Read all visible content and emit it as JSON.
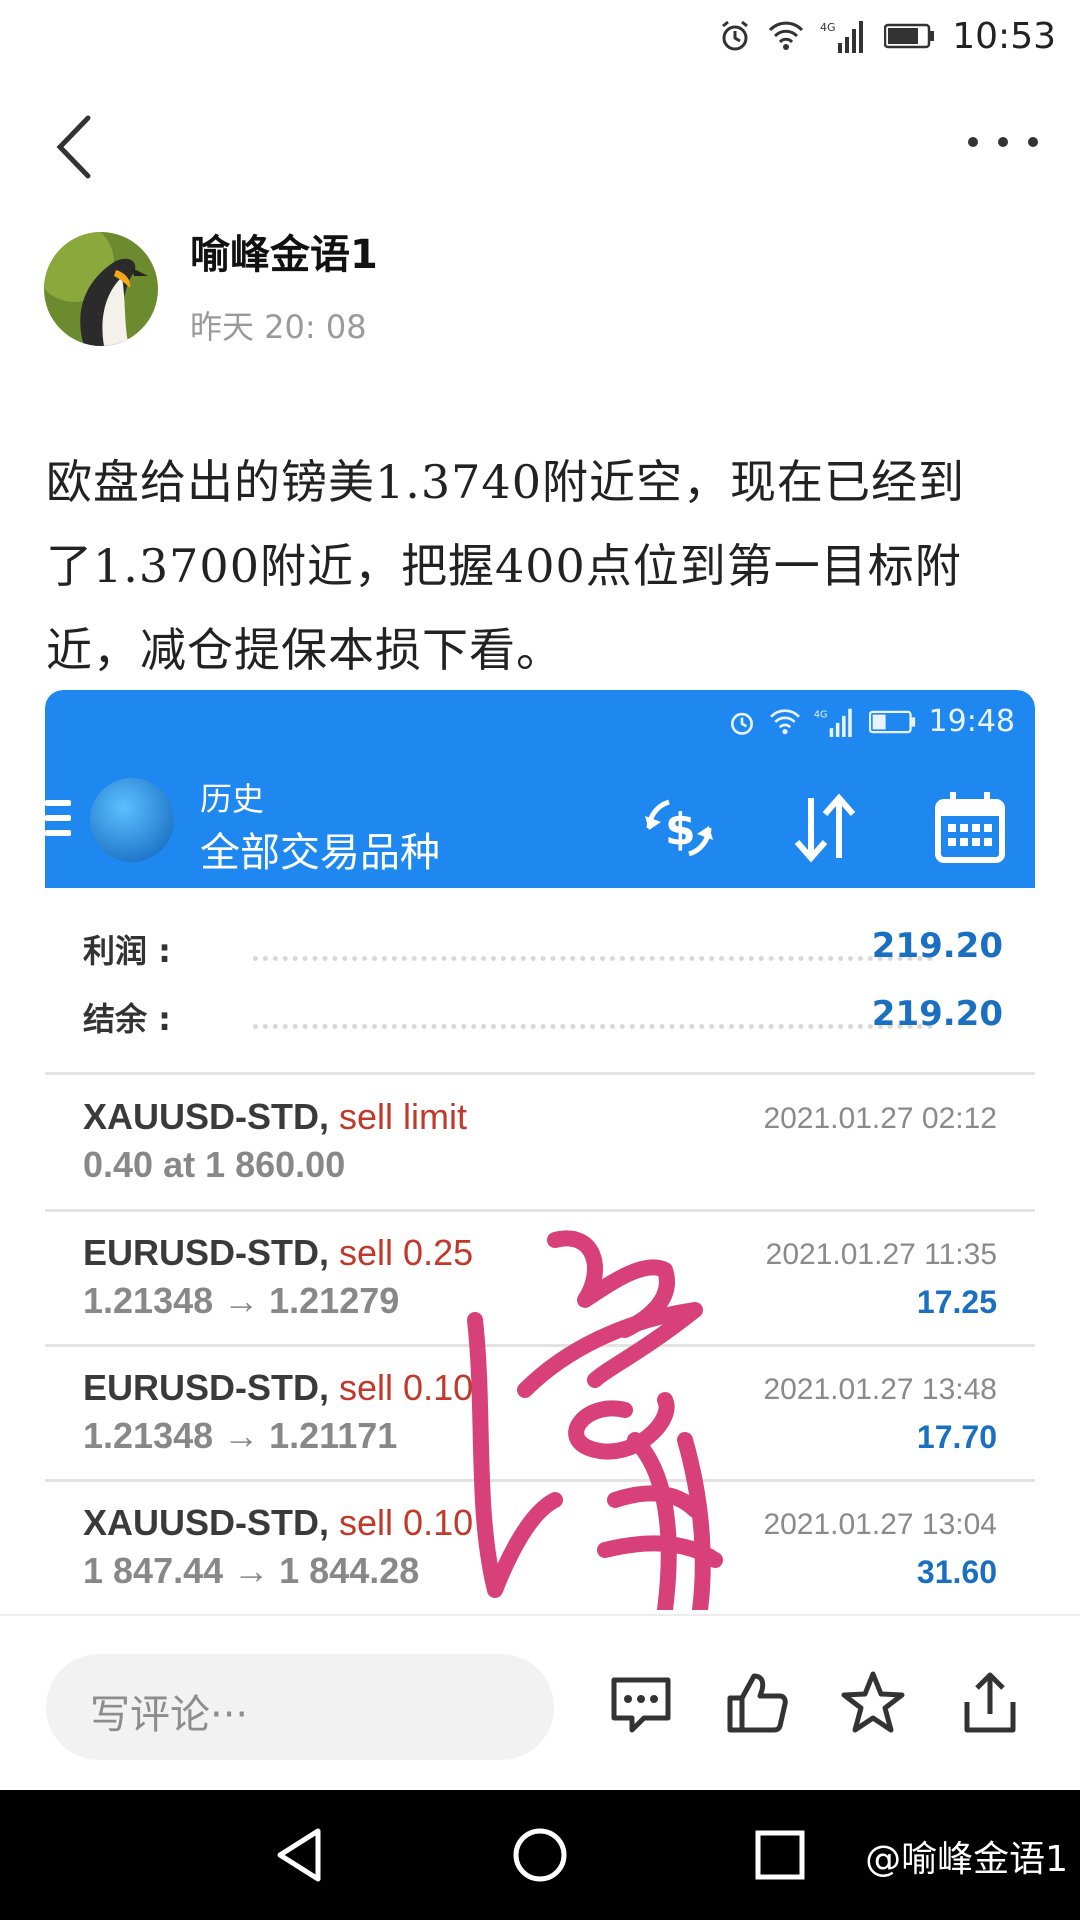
{
  "status_bar": {
    "time": "10:53",
    "network": "4G"
  },
  "nav": {
    "back_icon": "chevron-left-icon",
    "more_icon": "more-horizontal-icon"
  },
  "author": {
    "name": "喻峰金语1",
    "time": "昨天 20: 08"
  },
  "post": {
    "lines": [
      "欧盘给出的镑美1.3740附近空，现在已经到",
      "了1.3700附近，把握400点位到第一目标附",
      "近，减仓提保本损下看。"
    ]
  },
  "embed": {
    "status_time": "19:48",
    "network": "4G",
    "header_title": "历史",
    "header_subtitle": "全部交易品种",
    "header_icons": [
      "currency-exchange-icon",
      "sort-icon",
      "calendar-icon"
    ],
    "summary": [
      {
        "label": "利润 :",
        "value": "219.20"
      },
      {
        "label": "结余 :",
        "value": "219.20"
      }
    ],
    "trades": [
      {
        "symbol": "XAUUSD-STD,",
        "type": "sell limit",
        "detail": "0.40 at 1 860.00",
        "date": "2021.01.27 02:12",
        "profit": ""
      },
      {
        "symbol": "EURUSD-STD,",
        "type": "sell 0.25",
        "detail": "1.21348 → 1.21279",
        "date": "2021.01.27 11:35",
        "profit": "17.25"
      },
      {
        "symbol": "EURUSD-STD,",
        "type": "sell 0.10",
        "detail": "1.21348 → 1.21171",
        "date": "2021.01.27 13:48",
        "profit": "17.70"
      },
      {
        "symbol": "XAUUSD-STD,",
        "type": "sell 0.10",
        "detail": "1 847.44 → 1 844.28",
        "date": "2021.01.27 13:04",
        "profit": "31.60"
      }
    ],
    "signature_color": "#d8407a"
  },
  "comment_bar": {
    "placeholder": "写评论···",
    "icons": [
      "comment-icon",
      "like-icon",
      "star-icon",
      "share-icon"
    ]
  },
  "android_nav": {
    "icons": [
      "back-triangle-icon",
      "home-circle-icon",
      "recents-square-icon"
    ],
    "watermark": "@喻峰金语1"
  },
  "colors": {
    "accent": "#1e88f0",
    "profit": "#1a6fc1",
    "sell": "#c0392b"
  }
}
